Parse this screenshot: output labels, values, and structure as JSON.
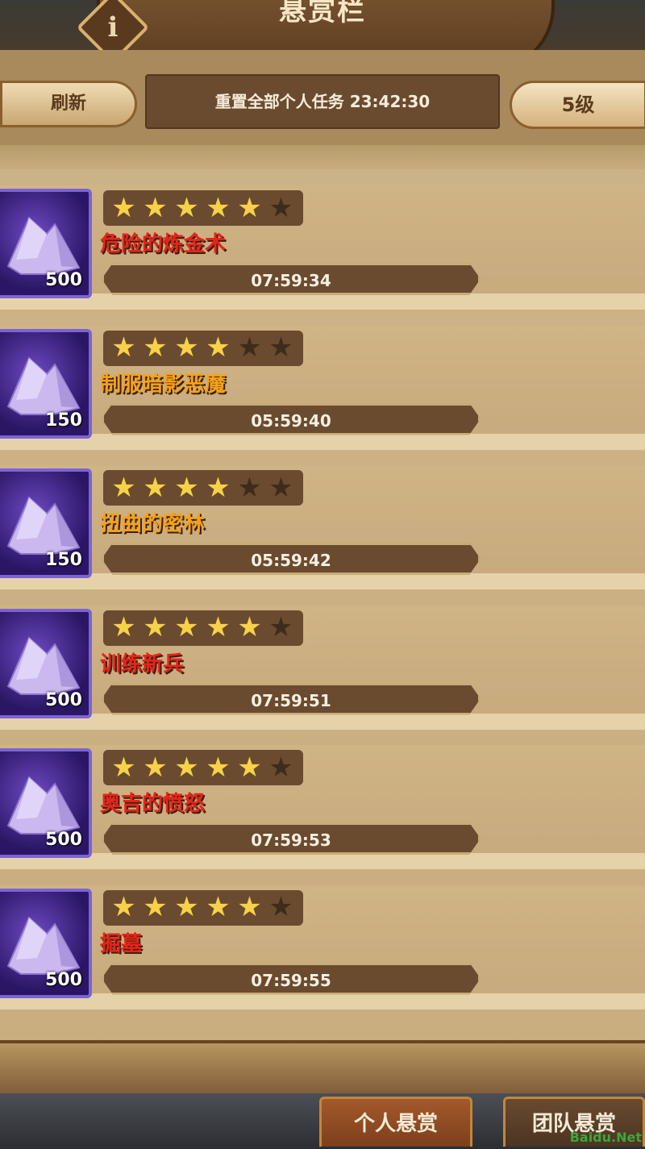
{
  "header": {
    "title": "悬赏栏",
    "info_glyph": "i",
    "refresh_label": "刷新",
    "reset_text": "重置全部个人任务 23:42:30",
    "level_label": "5级"
  },
  "bounties": [
    {
      "stars": 5,
      "max_stars": 6,
      "name": "危险的炼金术",
      "name_color": "#e8241a",
      "reward_icon": "purple-crystal-icon",
      "amount": "500",
      "timer": "07:59:34"
    },
    {
      "stars": 4,
      "max_stars": 6,
      "name": "制服暗影恶魔",
      "name_color": "#f5a11a",
      "reward_icon": "purple-crystal-icon",
      "amount": "150",
      "timer": "05:59:40"
    },
    {
      "stars": 4,
      "max_stars": 6,
      "name": "扭曲的密林",
      "name_color": "#f5a11a",
      "reward_icon": "purple-crystal-icon",
      "amount": "150",
      "timer": "05:59:42"
    },
    {
      "stars": 5,
      "max_stars": 6,
      "name": "训练新兵",
      "name_color": "#e8241a",
      "reward_icon": "purple-crystal-icon",
      "amount": "500",
      "timer": "07:59:51"
    },
    {
      "stars": 5,
      "max_stars": 6,
      "name": "奥吉的愤怒",
      "name_color": "#e8241a",
      "reward_icon": "purple-crystal-icon",
      "amount": "500",
      "timer": "07:59:53"
    },
    {
      "stars": 5,
      "max_stars": 6,
      "name": "掘墓",
      "name_color": "#e8241a",
      "reward_icon": "purple-crystal-icon",
      "amount": "500",
      "timer": "07:59:55"
    }
  ],
  "tabs": {
    "personal": "个人悬赏",
    "team": "团队悬赏"
  },
  "watermark": "Baidu.Net"
}
